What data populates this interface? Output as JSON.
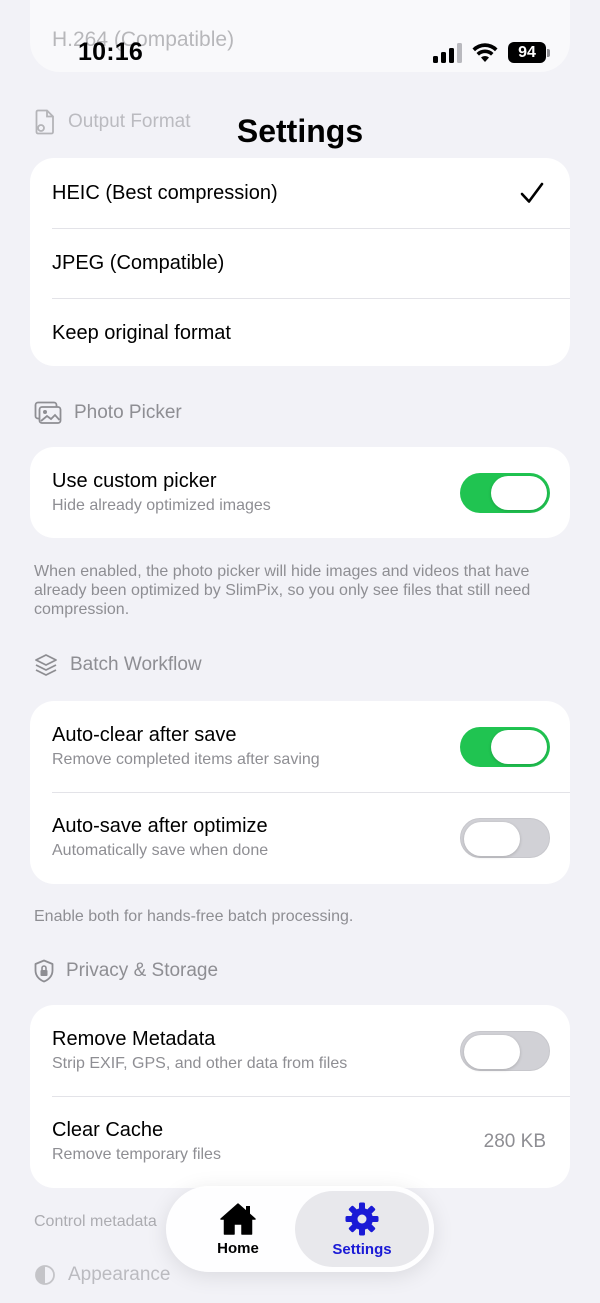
{
  "ghost_top": {
    "text": "H.264 (Compatible)"
  },
  "status_bar": {
    "time": "10:16",
    "battery": "94"
  },
  "nav": {
    "title": "Settings"
  },
  "output_format": {
    "header": "Output Format",
    "options": [
      {
        "label": "HEIC (Best compression)",
        "selected": true
      },
      {
        "label": "JPEG (Compatible)",
        "selected": false
      },
      {
        "label": "Keep original format",
        "selected": false
      }
    ]
  },
  "photo_picker": {
    "header": "Photo Picker",
    "custom_picker": {
      "title": "Use custom picker",
      "subtitle": "Hide already optimized images",
      "on": true
    },
    "footer": "When enabled, the photo picker will hide images and videos that have already been optimized by SlimPix, so you only see files that still need compression."
  },
  "batch_workflow": {
    "header": "Batch Workflow",
    "auto_clear": {
      "title": "Auto-clear after save",
      "subtitle": "Remove completed items after saving",
      "on": true
    },
    "auto_save": {
      "title": "Auto-save after optimize",
      "subtitle": "Automatically save when done",
      "on": false
    },
    "footer": "Enable both for hands-free batch processing."
  },
  "privacy_storage": {
    "header": "Privacy & Storage",
    "remove_metadata": {
      "title": "Remove Metadata",
      "subtitle": "Strip EXIF, GPS, and other data from files",
      "on": false
    },
    "clear_cache": {
      "title": "Clear Cache",
      "subtitle": "Remove temporary files",
      "value": "280 KB"
    },
    "footer": "Control metadata"
  },
  "appearance": {
    "header": "Appearance"
  },
  "tab_bar": {
    "home_label": "Home",
    "settings_label": "Settings",
    "active": "settings",
    "active_color": "#1a1ad6"
  },
  "colors": {
    "toggle_on": "#20c451",
    "background": "#f2f2f7"
  }
}
